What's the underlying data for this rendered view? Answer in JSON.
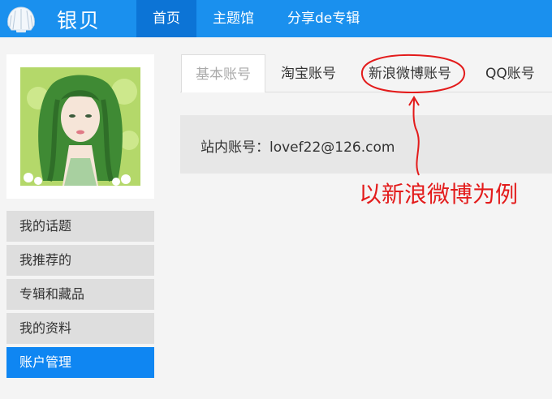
{
  "header": {
    "logo_text": "银贝",
    "logo_icon": "shell-icon",
    "nav": [
      {
        "label": "首页",
        "active": true
      },
      {
        "label": "主题馆",
        "active": false
      },
      {
        "label": "分享de专辑",
        "active": false
      }
    ]
  },
  "sidebar": {
    "avatar": "avatar-illustration",
    "items": [
      {
        "label": "我的话题"
      },
      {
        "label": "我推荐的"
      },
      {
        "label": "专辑和藏品"
      },
      {
        "label": "我的资料"
      },
      {
        "label": "账户管理",
        "active": true
      }
    ]
  },
  "tabs": [
    {
      "label": "基本账号",
      "active": true
    },
    {
      "label": "淘宝账号"
    },
    {
      "label": "新浪微博账号"
    },
    {
      "label": "QQ账号"
    }
  ],
  "account": {
    "text": "站内账号：lovef22@126.com"
  },
  "annotation": {
    "text": "以新浪微博为例",
    "color": "#e31b1b"
  },
  "colors": {
    "brand": "#1a90ee",
    "nav_active": "#0c74d6",
    "sidebar_active": "#0f86f2"
  }
}
